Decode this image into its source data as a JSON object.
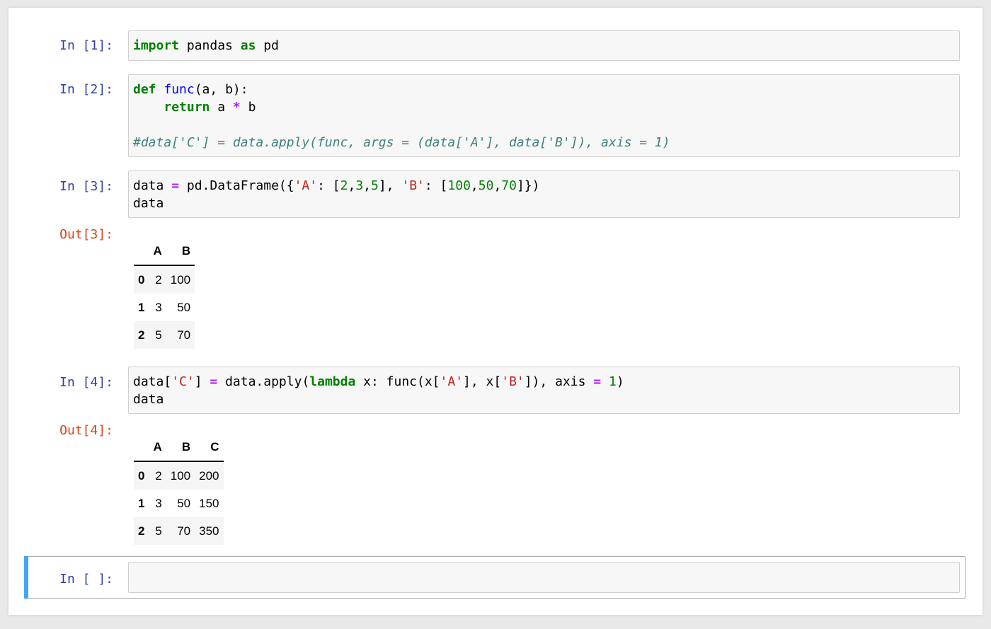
{
  "cells": [
    {
      "prompt": "In [1]:",
      "code": [
        [
          {
            "t": "import",
            "c": "kw"
          },
          {
            "t": " pandas "
          },
          {
            "t": "as",
            "c": "kw"
          },
          {
            "t": " pd"
          }
        ]
      ]
    },
    {
      "prompt": "In [2]:",
      "code": [
        [
          {
            "t": "def",
            "c": "kw"
          },
          {
            "t": " "
          },
          {
            "t": "func",
            "c": "fn"
          },
          {
            "t": "(a, b):"
          }
        ],
        [
          {
            "t": "    "
          },
          {
            "t": "return",
            "c": "kw"
          },
          {
            "t": " a "
          },
          {
            "t": "*",
            "c": "op"
          },
          {
            "t": " b"
          }
        ],
        [],
        [
          {
            "t": "#data['C'] = data.apply(func, args = (data['A'], data['B']), axis = 1)",
            "c": "cm"
          }
        ]
      ]
    },
    {
      "prompt": "In [3]:",
      "code": [
        [
          {
            "t": "data "
          },
          {
            "t": "=",
            "c": "op"
          },
          {
            "t": " pd.DataFrame({"
          },
          {
            "t": "'A'",
            "c": "str"
          },
          {
            "t": ": ["
          },
          {
            "t": "2",
            "c": "num"
          },
          {
            "t": ","
          },
          {
            "t": "3",
            "c": "num"
          },
          {
            "t": ","
          },
          {
            "t": "5",
            "c": "num"
          },
          {
            "t": "], "
          },
          {
            "t": "'B'",
            "c": "str"
          },
          {
            "t": ": ["
          },
          {
            "t": "100",
            "c": "num"
          },
          {
            "t": ","
          },
          {
            "t": "50",
            "c": "num"
          },
          {
            "t": ","
          },
          {
            "t": "70",
            "c": "num"
          },
          {
            "t": "]})"
          }
        ],
        [
          {
            "t": "data"
          }
        ]
      ],
      "output_prompt": "Out[3]:",
      "table": {
        "columns": [
          "",
          "A",
          "B"
        ],
        "rows": [
          [
            "0",
            "2",
            "100"
          ],
          [
            "1",
            "3",
            "50"
          ],
          [
            "2",
            "5",
            "70"
          ]
        ]
      }
    },
    {
      "prompt": "In [4]:",
      "code": [
        [
          {
            "t": "data["
          },
          {
            "t": "'C'",
            "c": "str"
          },
          {
            "t": "] "
          },
          {
            "t": "=",
            "c": "op"
          },
          {
            "t": " data.apply("
          },
          {
            "t": "lambda",
            "c": "kw"
          },
          {
            "t": " x: func(x["
          },
          {
            "t": "'A'",
            "c": "str"
          },
          {
            "t": "], x["
          },
          {
            "t": "'B'",
            "c": "str"
          },
          {
            "t": "]), axis "
          },
          {
            "t": "=",
            "c": "op"
          },
          {
            "t": " "
          },
          {
            "t": "1",
            "c": "num"
          },
          {
            "t": ")"
          }
        ],
        [
          {
            "t": "data"
          }
        ]
      ],
      "output_prompt": "Out[4]:",
      "table": {
        "columns": [
          "",
          "A",
          "B",
          "C"
        ],
        "rows": [
          [
            "0",
            "2",
            "100",
            "200"
          ],
          [
            "1",
            "3",
            "50",
            "150"
          ],
          [
            "2",
            "5",
            "70",
            "350"
          ]
        ]
      }
    },
    {
      "prompt": "In [ ]:",
      "code": []
    }
  ]
}
